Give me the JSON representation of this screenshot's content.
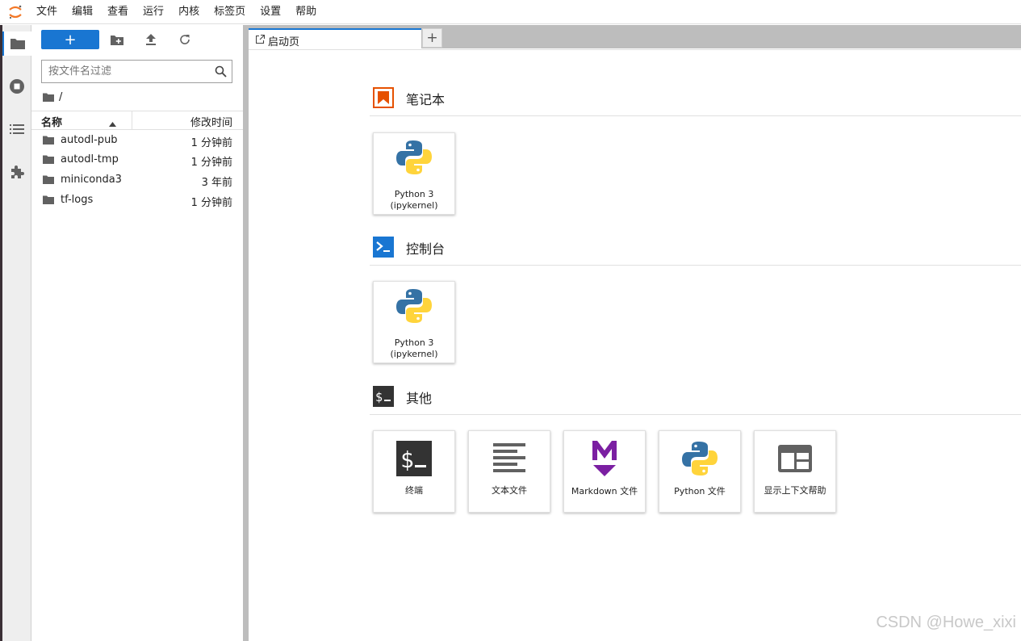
{
  "menubar": {
    "items": [
      "文件",
      "编辑",
      "查看",
      "运行",
      "内核",
      "标签页",
      "设置",
      "帮助"
    ]
  },
  "filebrowser": {
    "new_label": "+",
    "filter_placeholder": "按文件名过滤",
    "breadcrumb": "/",
    "columns": {
      "name": "名称",
      "modified": "修改时间"
    },
    "files": [
      {
        "name": "autodl-pub",
        "modified": "1 分钟前"
      },
      {
        "name": "autodl-tmp",
        "modified": "1 分钟前"
      },
      {
        "name": "miniconda3",
        "modified": "3 年前"
      },
      {
        "name": "tf-logs",
        "modified": "1 分钟前"
      }
    ]
  },
  "tabs": {
    "launcher_label": "启动页",
    "add_label": "+"
  },
  "launcher": {
    "sections": [
      {
        "title": "笔记本",
        "cards": [
          {
            "label1": "Python 3",
            "label2": "(ipykernel)"
          }
        ]
      },
      {
        "title": "控制台",
        "cards": [
          {
            "label1": "Python 3",
            "label2": "(ipykernel)"
          }
        ]
      },
      {
        "title": "其他",
        "cards": [
          {
            "label1": "终端"
          },
          {
            "label1": "文本文件"
          },
          {
            "label1": "Markdown 文件"
          },
          {
            "label1": "Python 文件"
          },
          {
            "label1": "显示上下文帮助"
          }
        ]
      }
    ]
  },
  "watermark": "CSDN @Howe_xixi",
  "colors": {
    "accent": "#1976d2",
    "notebook_orange": "#e65100",
    "markdown_purple": "#7b1fa2",
    "terminal_dark": "#333333"
  }
}
